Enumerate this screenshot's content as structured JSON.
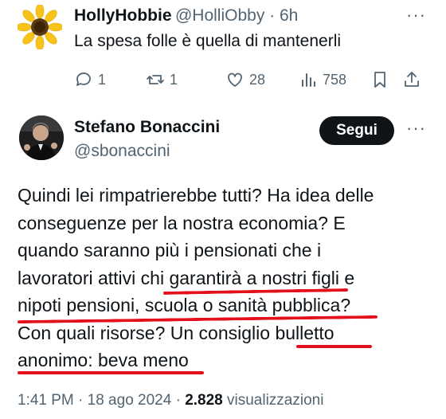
{
  "reply": {
    "name": "HollyHobbie",
    "handle": "@HolliObby · 6h",
    "text": "La spesa folle è quella di mantenerli",
    "replies": "1",
    "reposts": "1",
    "likes": "28",
    "views": "758",
    "more": "···"
  },
  "post": {
    "name": "Stefano Bonaccini",
    "handle": "@sbonaccini",
    "follow_label": "Segui",
    "more": "···",
    "lines": [
      "Quindi lei rimpatrierebbe tutti? Ha idea delle",
      "conseguenze per la nostra economia? E",
      "quando saranno più i pensionati che i",
      "lavoratori attivi chi garantirà a nostri figli e",
      "nipoti pensioni, scuola o sanità pubblica?",
      "Con quali risorse? Un consiglio bulletto",
      "anonimo: beva meno"
    ],
    "time": "1:41 PM · 18 ago 2024 · ",
    "views_count": "2.828",
    "views_label": " visualizzazioni"
  },
  "colors": {
    "underline": "#e3111c",
    "secondary_text": "#536471",
    "follow_bg": "#0f1419"
  }
}
